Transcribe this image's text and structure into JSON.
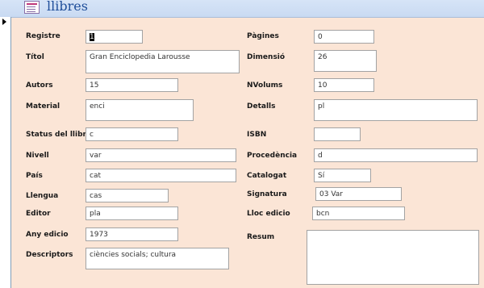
{
  "form": {
    "title": "llibres"
  },
  "fields": {
    "registre": {
      "label": "Registre",
      "value": "1"
    },
    "titol": {
      "label": "Títol",
      "value": "Gran Enciclopedia Larousse"
    },
    "autors": {
      "label": "Autors",
      "value": "15"
    },
    "material": {
      "label": "Material",
      "value": "enci"
    },
    "status": {
      "label": "Status del llibre",
      "value": "c"
    },
    "nivell": {
      "label": "Nivell",
      "value": "var"
    },
    "pais": {
      "label": "País",
      "value": "cat"
    },
    "llengua": {
      "label": "Llengua",
      "value": "cas"
    },
    "editor": {
      "label": "Editor",
      "value": "pla"
    },
    "any_edicio": {
      "label": "Any edicio",
      "value": "1973"
    },
    "descriptors": {
      "label": "Descriptors",
      "value": "ciències socials; cultura"
    },
    "pagines": {
      "label": "Pàgines",
      "value": "0"
    },
    "dimensio": {
      "label": "Dimensió",
      "value": "26"
    },
    "nvolums": {
      "label": "NVolums",
      "value": "10"
    },
    "detalls": {
      "label": "Detalls",
      "value": "pl"
    },
    "isbn": {
      "label": "ISBN",
      "value": ""
    },
    "procedencia": {
      "label": "Procedència",
      "value": "d"
    },
    "catalogat": {
      "label": "Catalogat",
      "value": "Sí"
    },
    "signatura": {
      "label": "Signatura",
      "value": "03 Var"
    },
    "lloc_edicio": {
      "label": "Lloc edicio",
      "value": "bcn"
    },
    "resum": {
      "label": "Resum",
      "value": ""
    }
  }
}
